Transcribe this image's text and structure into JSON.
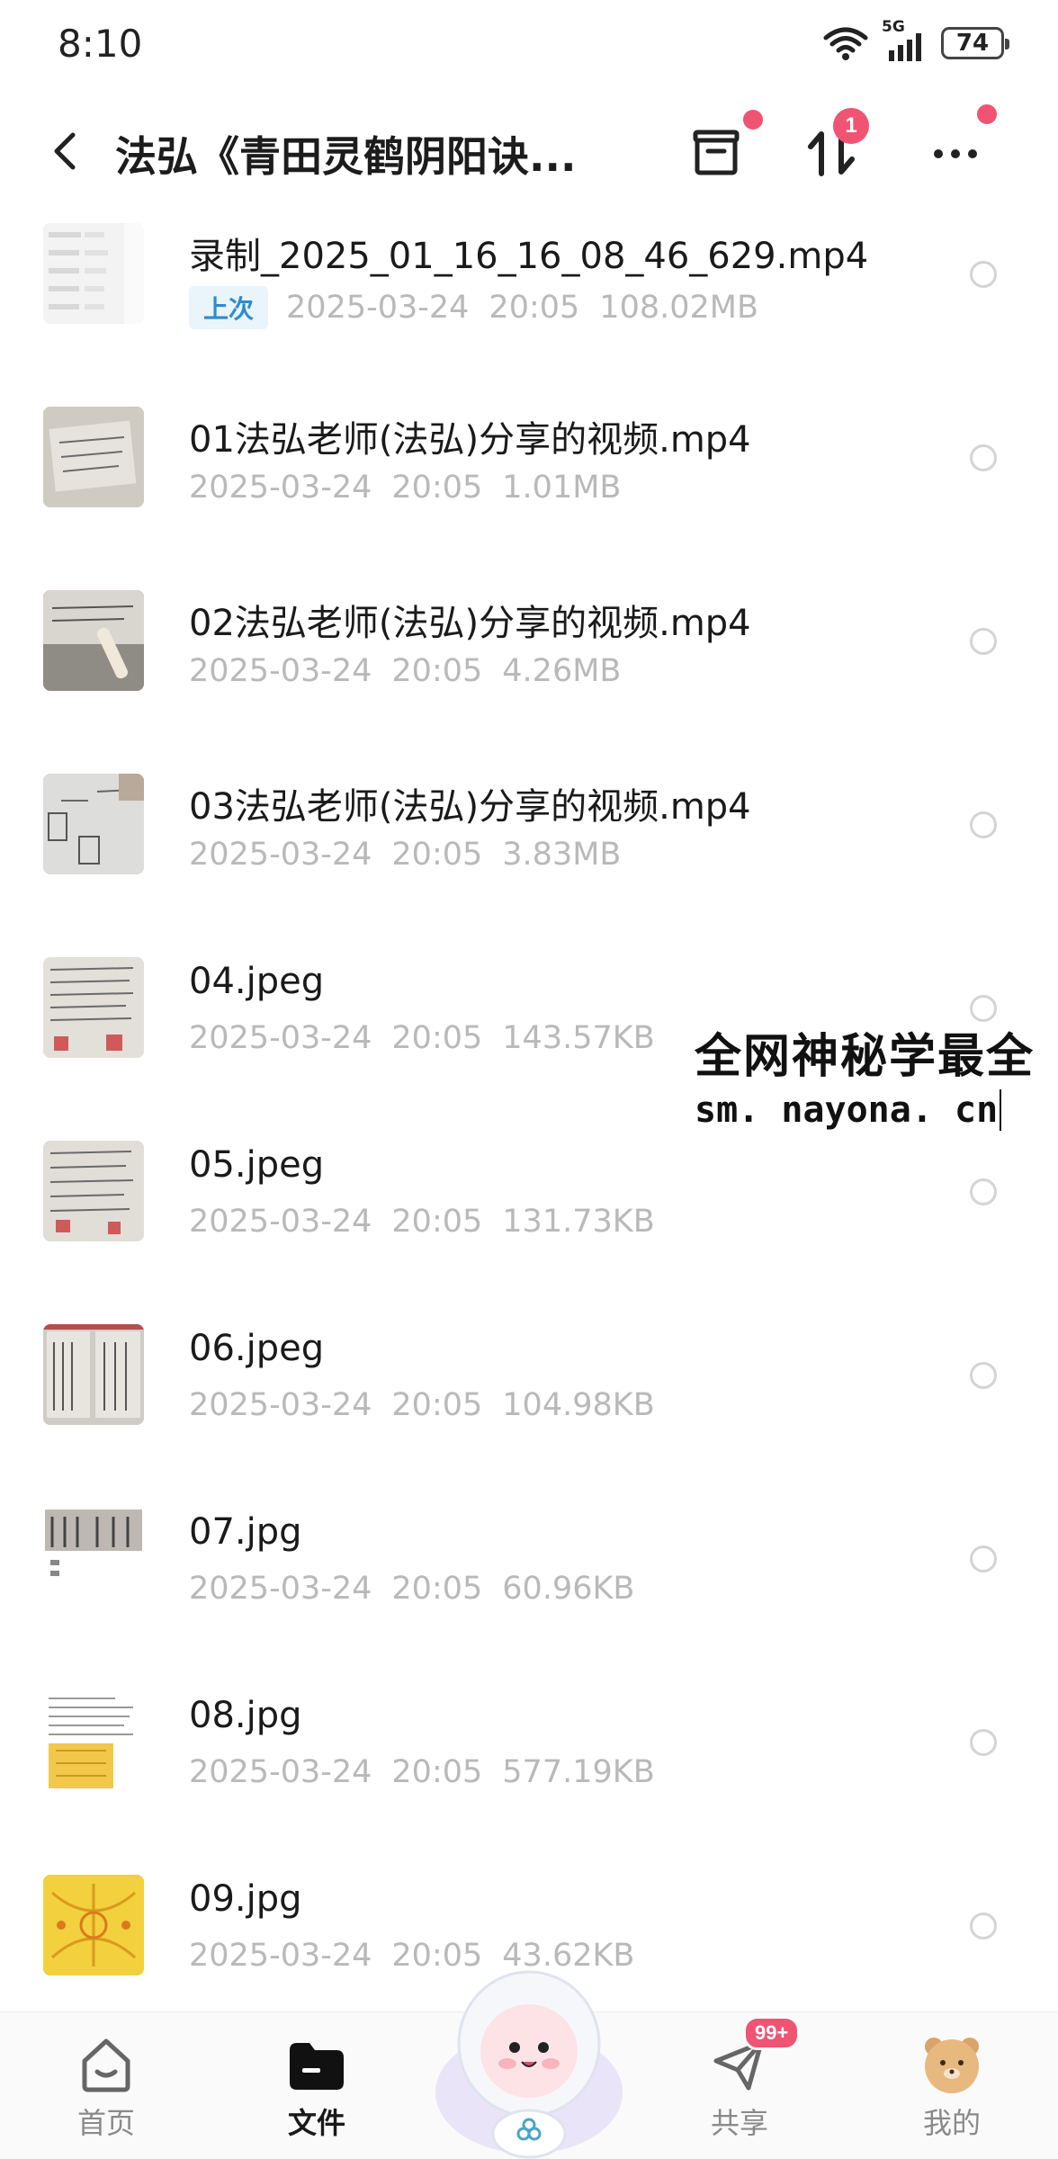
{
  "status_bar": {
    "time": "8:10",
    "network": "5G",
    "battery": "74",
    "icons": [
      "wifi-icon",
      "signal-icon",
      "battery-icon"
    ]
  },
  "header": {
    "title": "法弘《青田灵鹤阴阳诀...",
    "back_icon": "chevron-left-icon",
    "actions": [
      {
        "name": "archive-icon",
        "dot": true
      },
      {
        "name": "transfer-icon",
        "badge": "1"
      },
      {
        "name": "more-icon",
        "dot": true
      }
    ],
    "accent_color": "#f05472"
  },
  "files": [
    {
      "name": "录制_2025_01_16_16_08_46_629.mp4",
      "tag": "上次",
      "date": "2025-03-24",
      "time": "20:05",
      "size": "108.02MB"
    },
    {
      "name": "01法弘老师(法弘)分享的视频.mp4",
      "tag": "",
      "date": "2025-03-24",
      "time": "20:05",
      "size": "1.01MB"
    },
    {
      "name": "02法弘老师(法弘)分享的视频.mp4",
      "tag": "",
      "date": "2025-03-24",
      "time": "20:05",
      "size": "4.26MB"
    },
    {
      "name": "03法弘老师(法弘)分享的视频.mp4",
      "tag": "",
      "date": "2025-03-24",
      "time": "20:05",
      "size": "3.83MB"
    },
    {
      "name": "04.jpeg",
      "tag": "",
      "date": "2025-03-24",
      "time": "20:05",
      "size": "143.57KB"
    },
    {
      "name": "05.jpeg",
      "tag": "",
      "date": "2025-03-24",
      "time": "20:05",
      "size": "131.73KB"
    },
    {
      "name": "06.jpeg",
      "tag": "",
      "date": "2025-03-24",
      "time": "20:05",
      "size": "104.98KB"
    },
    {
      "name": "07.jpg",
      "tag": "",
      "date": "2025-03-24",
      "time": "20:05",
      "size": "60.96KB"
    },
    {
      "name": "08.jpg",
      "tag": "",
      "date": "2025-03-24",
      "time": "20:05",
      "size": "577.19KB"
    },
    {
      "name": "09.jpg",
      "tag": "",
      "date": "2025-03-24",
      "time": "20:05",
      "size": "43.62KB"
    }
  ],
  "watermark": {
    "line1": "全网神秘学最全",
    "line2": "sm. nayona. cn"
  },
  "bottom_nav": {
    "items": [
      {
        "label": "首页",
        "icon": "home-icon",
        "active": false
      },
      {
        "label": "文件",
        "icon": "folder-icon",
        "active": true
      },
      {
        "label": "共享",
        "icon": "share-send-icon",
        "active": false,
        "badge": "99+"
      },
      {
        "label": "我的",
        "icon": "avatar-icon",
        "active": false
      }
    ]
  }
}
